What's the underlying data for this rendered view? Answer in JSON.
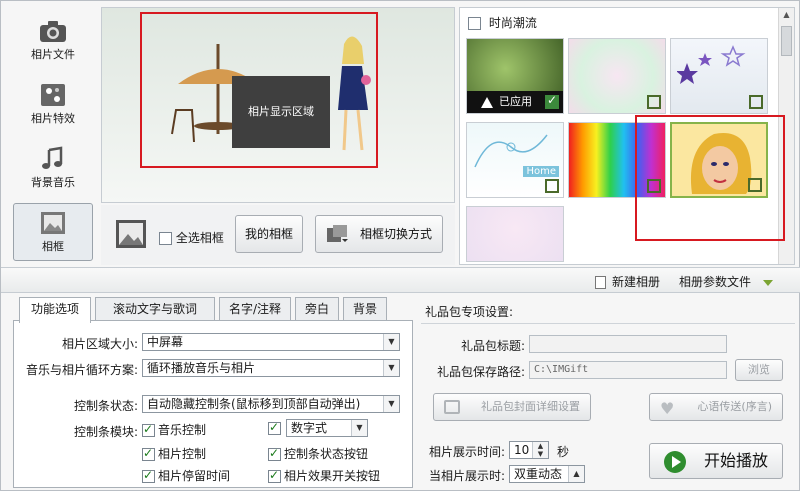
{
  "sidebar": {
    "items": [
      {
        "label": "相片文件",
        "icon": "camera-icon"
      },
      {
        "label": "相片特效",
        "icon": "effects-icon"
      },
      {
        "label": "背景音乐",
        "icon": "music-note-icon"
      },
      {
        "label": "相框",
        "icon": "frame-icon",
        "active": true
      }
    ]
  },
  "preview": {
    "photo_area_label": "相片显示区域"
  },
  "frame_toolbar": {
    "select_all_label": "全选相框",
    "my_frames_label": "我的相框",
    "switch_mode_label": "相框切换方式"
  },
  "gallery": {
    "category_label": "时尚潮流",
    "applied_label": "已应用",
    "home_caption": "Home"
  },
  "album_bar": {
    "new_album": "新建相册",
    "album_params": "相册参数文件"
  },
  "tabs": [
    "功能选项",
    "滚动文字与歌词",
    "名字/注释",
    "旁白",
    "背景"
  ],
  "options": {
    "photo_area_size_label": "相片区域大小:",
    "photo_area_size_value": "中屏幕",
    "loop_label": "音乐与相片循环方案:",
    "loop_value": "循环播放音乐与相片",
    "control_bar_label": "控制条状态:",
    "control_bar_value": "自动隐藏控制条(鼠标移到顶部自动弹出)",
    "control_module_label": "控制条模块:",
    "modules": {
      "music_control": "音乐控制",
      "digital_style": "数字式",
      "photo_control": "相片控制",
      "status_button": "控制条状态按钮",
      "photo_dwell": "相片停留时间",
      "effect_toggle": "相片效果开关按钮"
    }
  },
  "gift": {
    "title": "礼品包专项设置:",
    "gift_title_label": "礼品包标题:",
    "gift_title_value": "",
    "save_path_label": "礼品包保存路径:",
    "save_path_value": "C:\\IMGift",
    "browse_label": "浏览",
    "cover_settings_label": "礼品包封面详细设置",
    "message_label": "心语传送(序言)"
  },
  "playback": {
    "display_time_label": "相片展示时间:",
    "display_time_value": "10",
    "seconds_unit": "秒",
    "when_display_label": "当相片展示时:",
    "when_display_value": "双重动态",
    "start_label": "开始播放"
  },
  "colors": {
    "highlight_red": "#d71920",
    "check_green": "#1b7a1b",
    "start_green": "#2f8d2f"
  }
}
